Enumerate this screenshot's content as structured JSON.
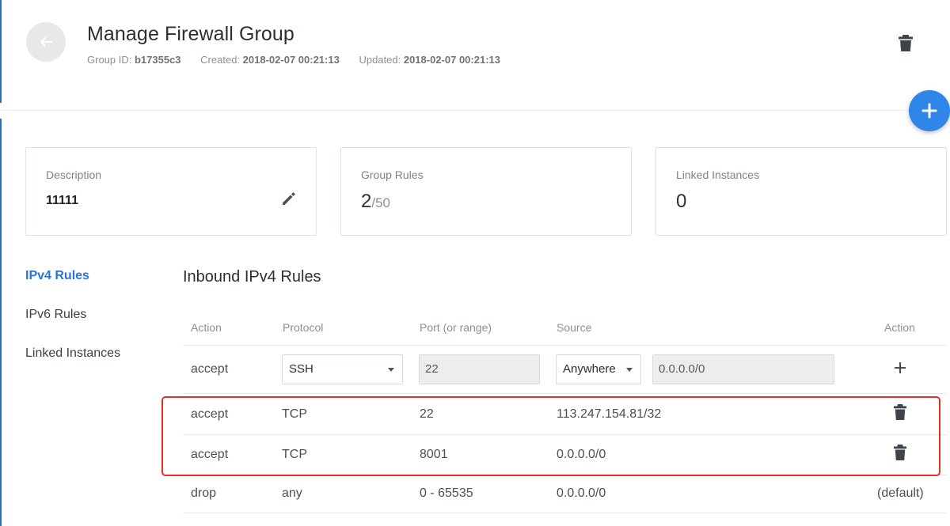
{
  "header": {
    "title": "Manage Firewall Group",
    "group_id_label": "Group ID:",
    "group_id": "b17355c3",
    "created_label": "Created:",
    "created": "2018-02-07 00:21:13",
    "updated_label": "Updated:",
    "updated": "2018-02-07 00:21:13",
    "back_icon": "arrow-left-icon",
    "delete_icon": "trash-icon",
    "fab_icon": "plus-icon"
  },
  "cards": {
    "description": {
      "label": "Description",
      "value": "11111"
    },
    "group_rules": {
      "label": "Group Rules",
      "value": "2",
      "max": "/50"
    },
    "linked_instances": {
      "label": "Linked Instances",
      "value": "0"
    }
  },
  "nav": {
    "items": [
      {
        "label": "IPv4 Rules",
        "active": true
      },
      {
        "label": "IPv6 Rules",
        "active": false
      },
      {
        "label": "Linked Instances",
        "active": false
      }
    ]
  },
  "section": {
    "title": "Inbound IPv4 Rules"
  },
  "table": {
    "columns": [
      "Action",
      "Protocol",
      "Port (or range)",
      "Source",
      "Action"
    ],
    "new_rule": {
      "action": "accept",
      "protocol": "SSH",
      "port": "22",
      "source_type": "Anywhere",
      "source": "0.0.0.0/0"
    },
    "rows": [
      {
        "action": "accept",
        "protocol": "TCP",
        "port": "22",
        "source": "113.247.154.81/32"
      },
      {
        "action": "accept",
        "protocol": "TCP",
        "port": "8001",
        "source": "0.0.0.0/0"
      }
    ],
    "default_row": {
      "action": "drop",
      "protocol": "any",
      "port": "0 - 65535",
      "source": "0.0.0.0/0",
      "note": "(default)"
    }
  },
  "colors": {
    "accent": "#2676d9",
    "fab": "#2f86e8",
    "highlight": "#e3302b"
  }
}
